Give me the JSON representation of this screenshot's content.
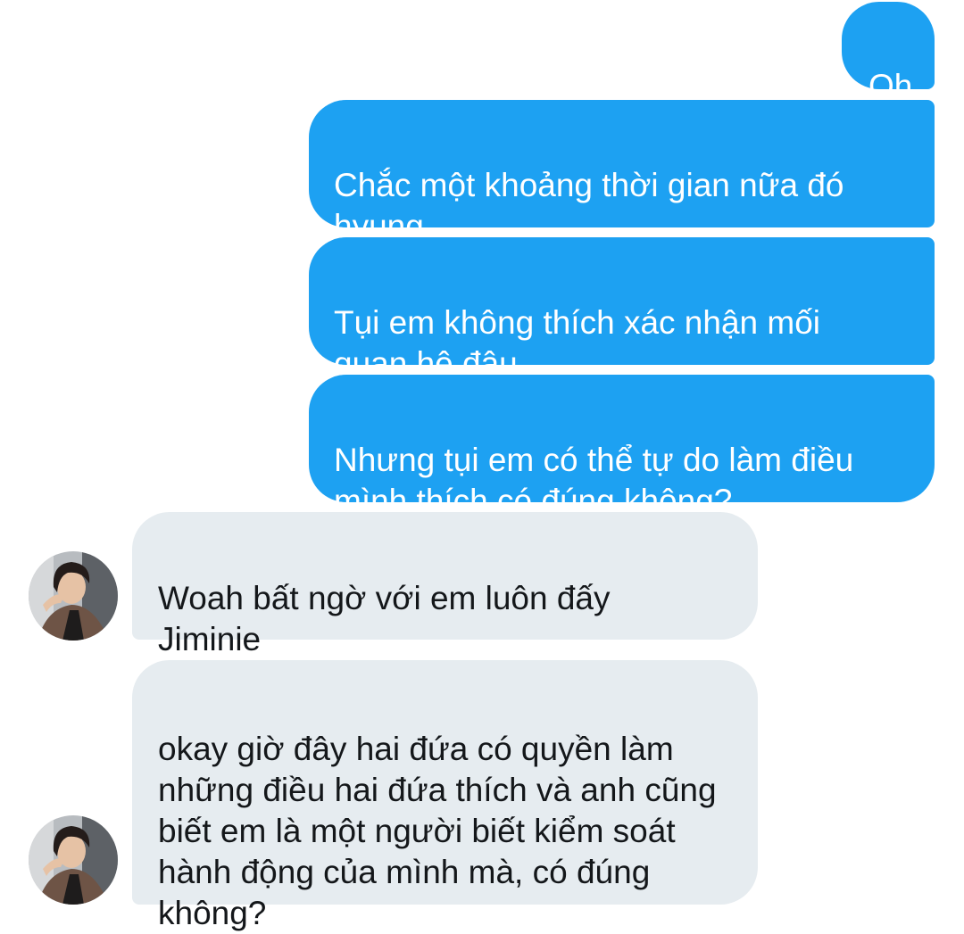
{
  "conversation": {
    "sent_messages": [
      {
        "text": "Oh"
      },
      {
        "text": "Chắc một khoảng thời gian nữa đó\nhyung"
      },
      {
        "text": "Tụi em không thích xác nhận mối\nquan hệ đâu"
      },
      {
        "text": "Nhưng tụi em có thể tự do làm điều\nmình thích có đúng không?"
      }
    ],
    "received_messages": [
      {
        "text": "Woah bất ngờ với em luôn đấy\nJiminie"
      },
      {
        "text": "okay giờ đây hai đứa có quyền làm\nnhững điều hai đứa thích và anh cũng\nbiết em là một người biết kiểm soát\nhành động của mình mà, có đúng\nkhông?"
      }
    ]
  },
  "colors": {
    "sent_bubble": "#1da1f2",
    "received_bubble": "#e6ecf0",
    "sent_text": "#ffffff",
    "received_text": "#14171a"
  },
  "icons": {
    "contact_avatar": "contact-avatar-photo"
  }
}
